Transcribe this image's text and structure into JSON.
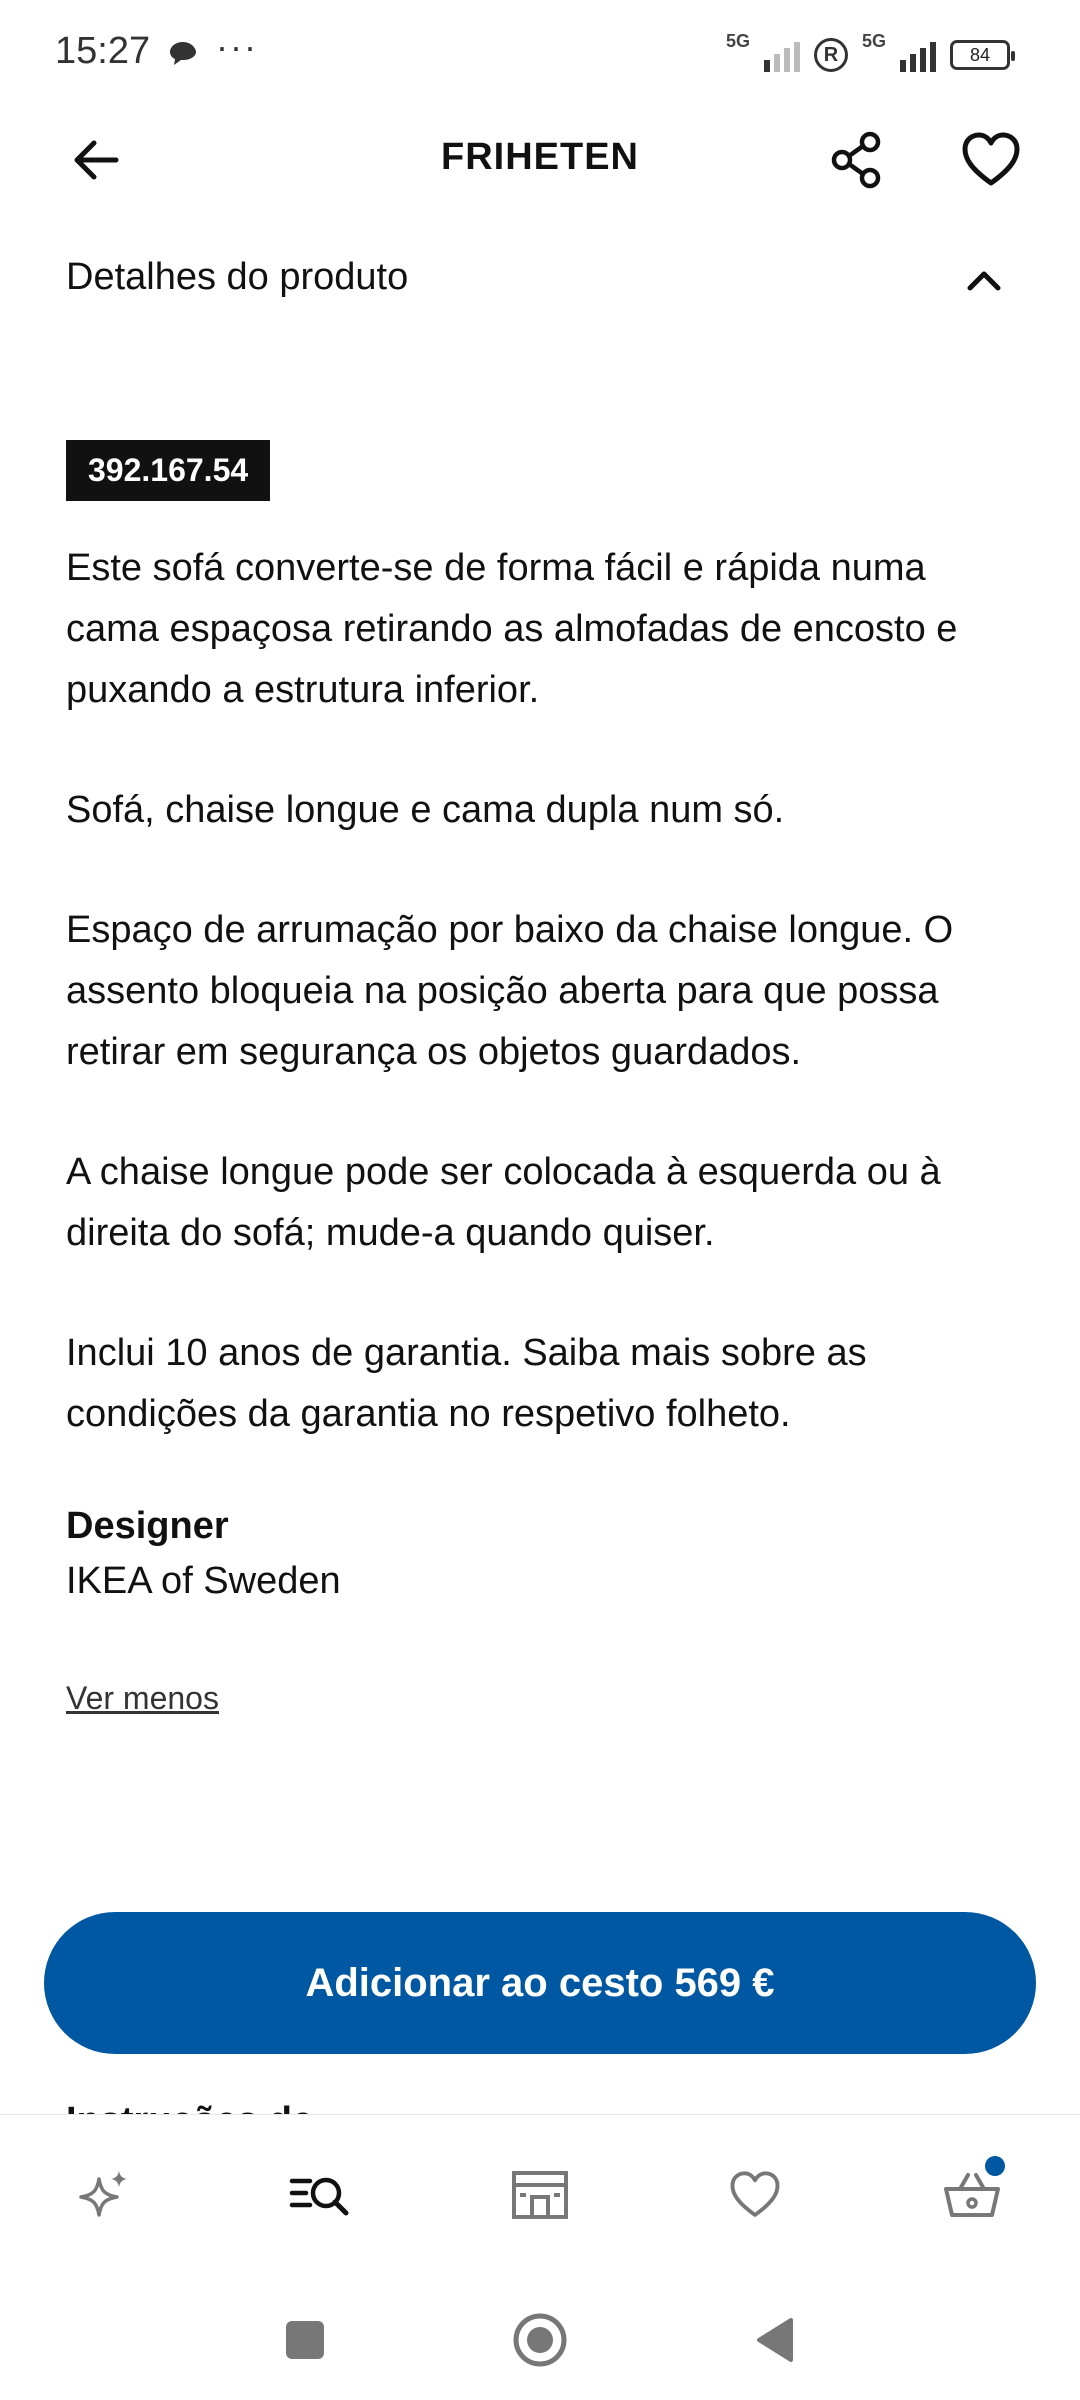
{
  "status_bar": {
    "time": "15:27",
    "network_1": "5G",
    "network_2": "5G",
    "roaming": "R",
    "battery": "84"
  },
  "header": {
    "title": "FRIHETEN"
  },
  "details": {
    "section_title": "Detalhes do produto",
    "article_number": "392.167.54",
    "paragraphs": [
      "Este sofá converte-se de forma fácil e rápida numa cama espaçosa retirando as almofadas de encosto e puxando a estrutura inferior.",
      "Sofá, chaise longue e cama dupla num só.",
      "Espaço de arrumação por baixo da chaise longue. O assento bloqueia na posição aberta para que possa retirar em segurança os objetos guardados.",
      "A chaise longue pode ser colocada à esquerda ou à direita do sofá; mude-a quando quiser.",
      "Inclui 10 anos de garantia. Saiba mais sobre as condições da garantia no respetivo folheto."
    ],
    "designer_label": "Designer",
    "designer_value": "IKEA of Sweden",
    "see_less": "Ver menos"
  },
  "cta": {
    "add_to_cart": "Adicionar ao cesto 569 €"
  },
  "peek": {
    "text": "Instruções de"
  },
  "bottom_nav": {
    "items": [
      "sparkle-icon",
      "search-list-icon",
      "store-icon",
      "heart-icon",
      "basket-icon"
    ]
  },
  "colors": {
    "brand_blue": "#0058a3",
    "badge_black": "#111111"
  }
}
